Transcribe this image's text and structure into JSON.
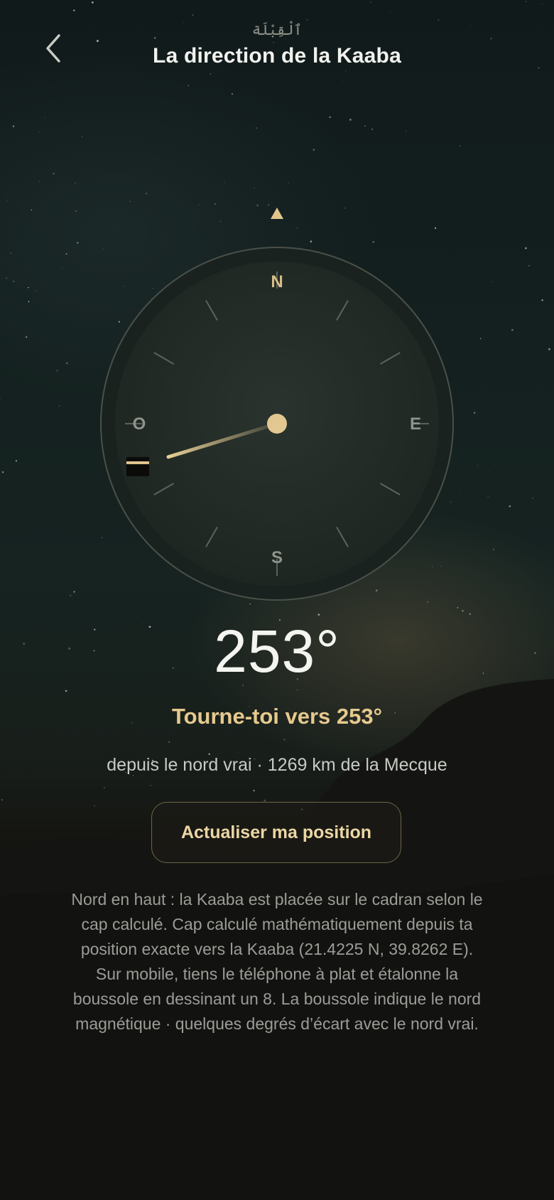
{
  "header": {
    "subtitle_ar": "ٱلْقِبْلَة",
    "title": "La direction de la Kaaba",
    "back_icon": "chevron-left-icon"
  },
  "compass": {
    "cardinals": {
      "north": "N",
      "east": "E",
      "south": "S",
      "west": "O"
    },
    "bearing_deg": 253,
    "indicator_icon": "triangle-up-icon",
    "kaaba_icon": "kaaba-icon",
    "colors": {
      "accent": "#e6c98e",
      "ring": "#1c2422",
      "face": "#27302b"
    }
  },
  "readout": {
    "heading": "253°",
    "instruction": "Tourne-toi vers 253°",
    "meta": "depuis le nord vrai · 1269 km de la Mecque"
  },
  "actions": {
    "refresh_label": "Actualiser ma position"
  },
  "info": {
    "text": "Nord en haut : la Kaaba est placée sur le cadran selon le cap calculé. Cap calculé mathématiquement depuis ta position exacte vers la Kaaba (21.4225 N, 39.8262 E). Sur mobile, tiens le téléphone à plat et étalonne la boussole en dessinant un 8. La boussole indique le nord magnétique · quelques degrés d’écart avec le nord vrai."
  }
}
